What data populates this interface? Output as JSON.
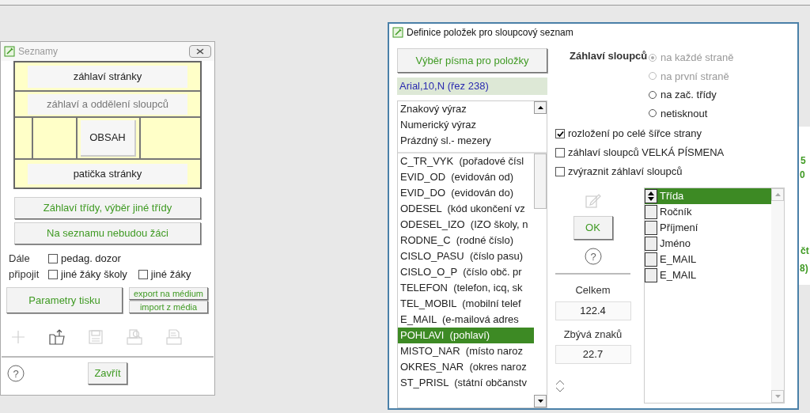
{
  "background_window": {
    "fragments": [
      "5",
      "0",
      "čt",
      "8)"
    ]
  },
  "help_icon": "?",
  "seznamy": {
    "title": "Seznamy",
    "layout": {
      "page_header": "záhlaví stránky",
      "column_header": "záhlaví a oddělení sloupců",
      "content": "OBSAH",
      "page_footer": "patička stránky"
    },
    "buttons": [
      "Záhlaví třídy, výběr jiné třídy",
      "Na seznamu nebudou žáci"
    ],
    "attach_label": "Dále připojit",
    "checkboxes": [
      {
        "label": "pedag. dozor",
        "checked": false
      },
      {
        "label": "jiné žáky školy",
        "checked": false
      },
      {
        "label": "jiné žáky",
        "checked": false
      }
    ],
    "print_button": "Parametry tisku",
    "export_button": "export na médium",
    "import_button": "import z média",
    "toolbar": [
      {
        "kind": "add",
        "disabled": true
      },
      {
        "kind": "open",
        "disabled": false
      },
      {
        "kind": "save",
        "disabled": true
      },
      {
        "kind": "preview",
        "disabled": true
      },
      {
        "kind": "print",
        "disabled": true
      }
    ],
    "close_button": "Zavřít"
  },
  "definice": {
    "title": "Definice položek pro sloupcový seznam",
    "font_button": "Výběr písma pro položky",
    "font_label": "Arial,10,N (řez 238)",
    "fixed_items": [
      "Znakový výraz",
      "Numerický výraz",
      "Prázdný sl.- mezery"
    ],
    "items": [
      {
        "label": "C_TR_VYK  (pořadové čísl",
        "selected": false
      },
      {
        "label": "EVID_OD  (evidován od)",
        "selected": false
      },
      {
        "label": "EVID_DO  (evidován do)",
        "selected": false
      },
      {
        "label": "ODESEL  (kód ukončení vz",
        "selected": false
      },
      {
        "label": "ODESEL_IZO  (IZO školy, n",
        "selected": false
      },
      {
        "label": "RODNE_C  (rodné číslo)",
        "selected": false
      },
      {
        "label": "CISLO_PASU  (číslo pasu)",
        "selected": false
      },
      {
        "label": "CISLO_O_P  (číslo obč. pr",
        "selected": false
      },
      {
        "label": "TELEFON  (telefon, icq, sk",
        "selected": false
      },
      {
        "label": "TEL_MOBIL  (mobilní telef",
        "selected": false
      },
      {
        "label": "E_MAIL  (e-mailová adres",
        "selected": false
      },
      {
        "label": "POHLAVI  (pohlaví)",
        "selected": true
      },
      {
        "label": "MISTO_NAR  (místo naroz",
        "selected": false
      },
      {
        "label": "OKRES_NAR  (okres naroz",
        "selected": false
      },
      {
        "label": "ST_PRISL  (státní občanstv",
        "selected": false
      }
    ],
    "header_label": "Záhlaví sloupců",
    "radios": [
      {
        "label": "na každé straně",
        "selected": true,
        "disabled": true
      },
      {
        "label": "na první straně",
        "selected": false,
        "disabled": true
      },
      {
        "label": "na zač. třídy",
        "selected": false,
        "disabled": false
      },
      {
        "label": "netisknout",
        "selected": false,
        "disabled": false
      }
    ],
    "checkboxes": [
      {
        "label": "rozložení po celé šířce strany",
        "checked": true
      },
      {
        "label": "záhlaví sloupců VELKÁ PÍSMENA",
        "checked": false
      },
      {
        "label": "zvýraznit záhlaví sloupců",
        "checked": false
      }
    ],
    "ok_button": "OK",
    "total_label": "Celkem",
    "total_value": "122.4",
    "remaining_label": "Zbývá znaků",
    "remaining_value": "22.7",
    "columns": [
      {
        "label": "Třída",
        "selected": true
      },
      {
        "label": "Ročník",
        "selected": false
      },
      {
        "label": "Příjmení",
        "selected": false
      },
      {
        "label": "Jméno",
        "selected": false
      },
      {
        "label": "E_MAIL",
        "selected": false
      },
      {
        "label": "E_MAIL",
        "selected": false
      }
    ]
  }
}
